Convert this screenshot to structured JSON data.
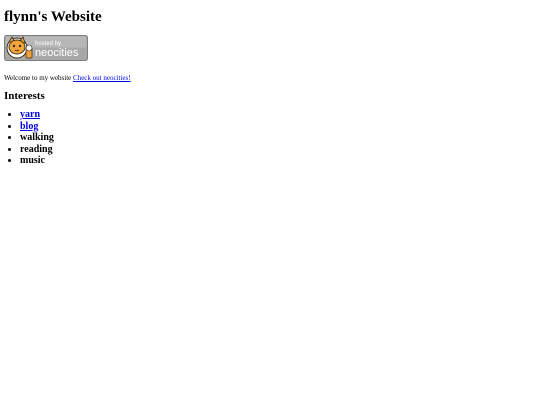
{
  "page": {
    "title": "flynn's Website",
    "badge": {
      "text_top": "hosted by",
      "text_main": "neocities",
      "icon": "neocities-cat-icon"
    },
    "welcome": {
      "text": "Welcome to my website",
      "link_text": "Check out neocities!"
    },
    "interests": {
      "heading": "Interests",
      "items": [
        {
          "label": "yarn",
          "link": true
        },
        {
          "label": "blog",
          "link": true
        },
        {
          "label": "walking",
          "link": false
        },
        {
          "label": "reading",
          "link": false
        },
        {
          "label": "music",
          "link": false
        }
      ]
    }
  },
  "colors": {
    "link": "#0000ee",
    "text": "#000000",
    "badge_bg": "#a5a5a5",
    "badge_cat": "#f2a33a"
  }
}
